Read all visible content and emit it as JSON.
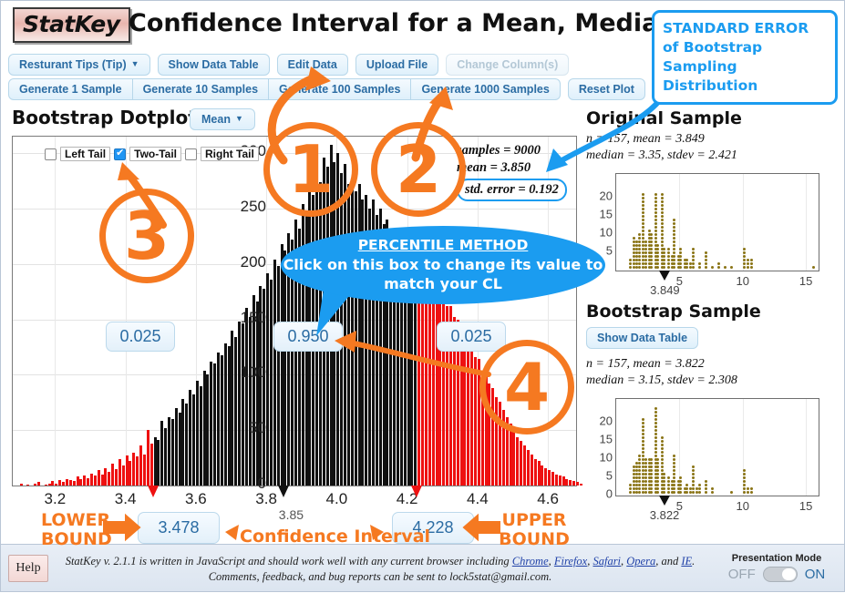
{
  "header": {
    "logo": "StatKey",
    "title": "Confidence Interval for a Mean, Median, Std. Dev."
  },
  "toolbar": {
    "dataset_label": "Resturant Tips (Tip)",
    "show_data_table": "Show Data Table",
    "edit_data": "Edit Data",
    "upload_file": "Upload File",
    "change_columns": "Change Column(s)",
    "generate_1": "Generate 1 Sample",
    "generate_10": "Generate 10 Samples",
    "generate_100": "Generate 100 Samples",
    "generate_1000": "Generate 1000 Samples",
    "reset_plot": "Reset Plot"
  },
  "main": {
    "plot_title": "Bootstrap Dotplot of",
    "statistic": "Mean",
    "tails": [
      {
        "label": "Left Tail",
        "checked": false
      },
      {
        "label": "Two-Tail",
        "checked": true
      },
      {
        "label": "Right Tail",
        "checked": false
      }
    ],
    "stats": {
      "samples_line": "samples = 9000",
      "mean_line": "mean = 3.850",
      "std_error_line": "std. error = 0.192"
    },
    "proportions": {
      "left": "0.025",
      "middle": "0.950",
      "right": "0.025"
    },
    "bounds": {
      "lower": "3.478",
      "upper": "4.228"
    },
    "center_marker": "3.85"
  },
  "chart_data": {
    "type": "bar",
    "title": "Bootstrap Dotplot of Mean",
    "xlabel": "",
    "ylabel": "",
    "xlim": [
      3.08,
      4.68
    ],
    "ylim": [
      0,
      315
    ],
    "grid": true,
    "xticks": [
      "3.2",
      "3.4",
      "3.6",
      "3.8",
      "4.0",
      "4.2",
      "4.4",
      "4.6"
    ],
    "xtick_values": [
      3.2,
      3.4,
      3.6,
      3.8,
      4.0,
      4.2,
      4.4,
      4.6
    ],
    "yticks": [
      "0",
      "50",
      "100",
      "150",
      "200",
      "250",
      "300"
    ],
    "ytick_values": [
      0,
      50,
      100,
      150,
      200,
      250,
      300
    ],
    "lower_bound": 3.478,
    "upper_bound": 4.228,
    "center": 3.85,
    "tail_color": "#ee1111",
    "body_color": "#111111",
    "bin_width": 0.01,
    "x_start": 3.1,
    "values": [
      2,
      0,
      1,
      0,
      2,
      3,
      0,
      1,
      2,
      4,
      2,
      5,
      3,
      6,
      5,
      4,
      8,
      6,
      9,
      7,
      11,
      9,
      14,
      10,
      16,
      12,
      20,
      15,
      24,
      18,
      27,
      22,
      30,
      26,
      36,
      28,
      50,
      38,
      44,
      41,
      58,
      52,
      62,
      60,
      70,
      66,
      78,
      74,
      86,
      82,
      95,
      90,
      104,
      100,
      112,
      110,
      120,
      118,
      128,
      126,
      140,
      134,
      148,
      146,
      160,
      152,
      172,
      166,
      180,
      178,
      192,
      186,
      204,
      198,
      218,
      212,
      228,
      222,
      240,
      232,
      254,
      248,
      268,
      262,
      284,
      274,
      296,
      288,
      308,
      292,
      300,
      282,
      290,
      272,
      278,
      266,
      272,
      258,
      262,
      250,
      258,
      244,
      250,
      236,
      240,
      228,
      232,
      220,
      224,
      212,
      214,
      204,
      206,
      196,
      198,
      188,
      190,
      180,
      182,
      172,
      172,
      162,
      162,
      152,
      150,
      140,
      138,
      128,
      126,
      116,
      114,
      104,
      100,
      92,
      88,
      80,
      76,
      68,
      62,
      56,
      50,
      44,
      40,
      36,
      32,
      28,
      24,
      22,
      18,
      16,
      14,
      12,
      10,
      9,
      8,
      6,
      5,
      4,
      3,
      2
    ]
  },
  "original_sample": {
    "title": "Original Sample",
    "stats_line1": "n = 157, mean = 3.849",
    "stats_line2": "median = 3.35, stdev = 2.421",
    "mean_marker": "3.849",
    "xticks": [
      "5",
      "10",
      "15"
    ],
    "yticks": [
      "20",
      "15",
      "10",
      "5"
    ],
    "dot_color": "#8a7415"
  },
  "bootstrap_sample": {
    "title": "Bootstrap Sample",
    "show_data_table": "Show Data Table",
    "stats_line1": "n = 157, mean = 3.822",
    "stats_line2": "median = 3.15, stdev = 2.308",
    "mean_marker": "3.822",
    "xticks": [
      "5",
      "10",
      "15"
    ],
    "yticks": [
      "20",
      "15",
      "10",
      "5",
      "0"
    ],
    "dot_color": "#8a7415"
  },
  "annotations": {
    "circle1": "1",
    "circle2": "2",
    "circle3": "3",
    "circle4": "4",
    "standard_error_callout": "STANDARD ERROR of Bootstrap Sampling Distribution",
    "percentile_title": "PERCENTILE METHOD",
    "percentile_body": "Click on this box to change its value to match your CL",
    "lower_bound_label": "LOWER BOUND",
    "upper_bound_label": "UPPER BOUND",
    "confidence_interval_label": "Confidence Interval",
    "accent_color": "#f57921",
    "callout_color": "#1b9cf0"
  },
  "footer": {
    "help": "Help",
    "line1_a": "StatKey v. 2.1.1 is written in JavaScript and should work well with any current browser including ",
    "browsers": [
      "Chrome",
      "Firefox",
      "Safari",
      "Opera",
      "IE"
    ],
    "line1_b": ", and ",
    "line2": "Comments, feedback, and bug reports can be sent to lock5stat@gmail.com.",
    "presentation_mode": "Presentation Mode",
    "off": "OFF",
    "on": "ON"
  }
}
